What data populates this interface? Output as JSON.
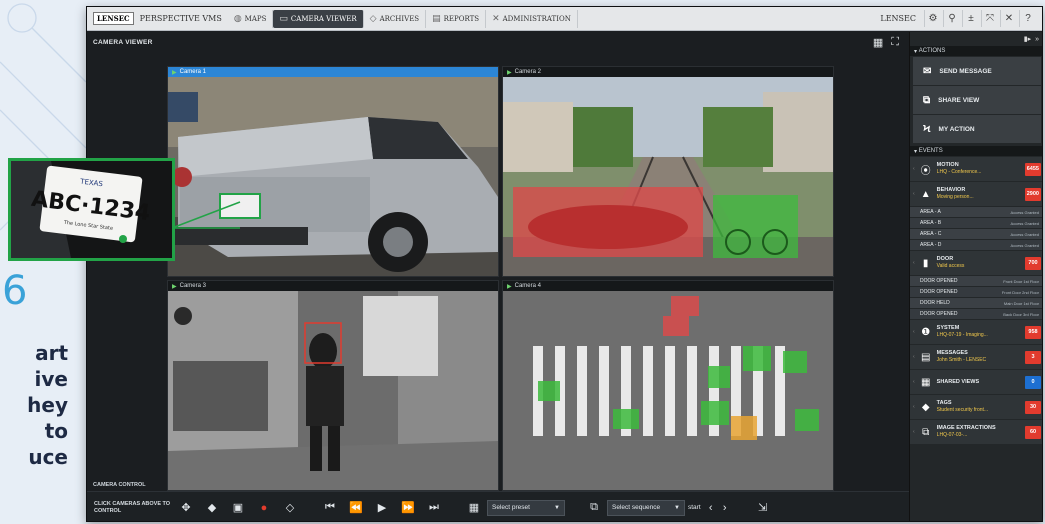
{
  "side": {
    "number": "6",
    "lines": [
      "art",
      "ive",
      "hey",
      "to",
      "uce"
    ]
  },
  "topbar": {
    "logo": "LENSEC",
    "brand": "PERSPECTIVE VMS",
    "tabs": [
      {
        "label": "MAPS",
        "icon": "globe-icon"
      },
      {
        "label": "CAMERA VIEWER",
        "icon": "monitor-icon"
      },
      {
        "label": "ARCHIVES",
        "icon": "archive-icon"
      },
      {
        "label": "REPORTS",
        "icon": "document-icon"
      },
      {
        "label": "ADMINISTRATION",
        "icon": "tools-icon"
      }
    ],
    "right_brand": "LENSEC",
    "tools": [
      "gear-icon",
      "search-icon",
      "help-dots-icon",
      "expand-icon",
      "close-icon",
      "question-icon"
    ]
  },
  "viewer": {
    "title": "CAMERA VIEWER",
    "cameras": [
      {
        "label": "Camera 1"
      },
      {
        "label": "Camera 2"
      },
      {
        "label": "Camera 3"
      },
      {
        "label": "Camera 4"
      }
    ],
    "plate": "ABC·1234",
    "plate_state": "TEXAS",
    "plate_slogan": "The Lone Star State",
    "control_title": "CAMERA CONTROL",
    "control_hint": "CLICK CAMERAS ABOVE TO CONTROL",
    "preset_placeholder": "Select preset",
    "sequence_placeholder": "Select sequence",
    "start_label": "start"
  },
  "panel": {
    "actions_title": "ACTIONS",
    "actions": [
      {
        "label": "SEND MESSAGE",
        "icon": "envelope-icon"
      },
      {
        "label": "SHARE VIEW",
        "icon": "share-icon"
      },
      {
        "label": "MY ACTION",
        "icon": "bolt-icon"
      }
    ],
    "events_title": "EVENTS",
    "events": [
      {
        "name": "MOTION",
        "sub": "LHQ - Conference...",
        "count": "6455",
        "icon": "motion-icon"
      },
      {
        "name": "BEHAVIOR",
        "sub": "Moving person...",
        "count": "2900",
        "icon": "warning-icon"
      },
      {
        "name": "DOOR",
        "sub": "Valid access",
        "count": "700",
        "icon": "door-icon"
      },
      {
        "name": "SYSTEM",
        "sub": "LHQ-07-19 - Imaging...",
        "count": "958",
        "icon": "alert-icon"
      },
      {
        "name": "MESSAGES",
        "sub": "John Smith - LENSEC",
        "count": "3",
        "icon": "message-icon"
      },
      {
        "name": "SHARED VIEWS",
        "sub": "",
        "count": "0",
        "icon": "shared-view-icon"
      },
      {
        "name": "TAGS",
        "sub": "Student security front...",
        "count": "30",
        "icon": "tag-icon"
      },
      {
        "name": "IMAGE EXTRACTIONS",
        "sub": "LHQ-07-03-...",
        "count": "60",
        "icon": "image-extract-icon"
      }
    ],
    "areas": [
      {
        "name": "AREA - A",
        "status": "Access Granted"
      },
      {
        "name": "AREA - B",
        "status": "Access Granted"
      },
      {
        "name": "AREA - C",
        "status": "Access Granted"
      },
      {
        "name": "AREA - D",
        "status": "Access Granted"
      }
    ],
    "doors": [
      {
        "name": "DOOR OPENED",
        "status": "Front Door 1st Floor"
      },
      {
        "name": "DOOR OPENED",
        "status": "Front Door 2nd Floor"
      },
      {
        "name": "DOOR HELD",
        "status": "Main Door 1st Floor"
      },
      {
        "name": "DOOR OPENED",
        "status": "Back Door 3rd Floor"
      }
    ]
  },
  "colors": {
    "accent_blue": "#2c86d6",
    "alert_red": "#e23b2e",
    "highlight_green": "#22a347"
  }
}
